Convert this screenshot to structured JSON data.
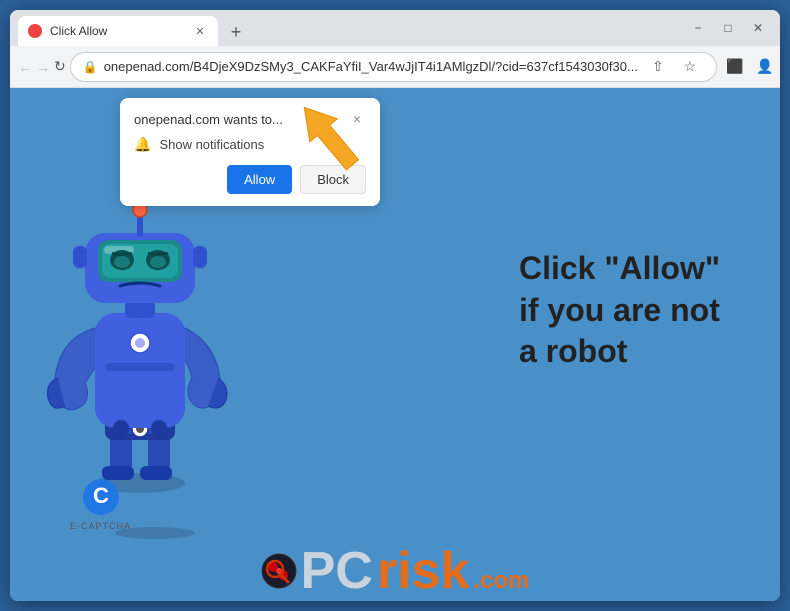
{
  "browser": {
    "title": "Click Allow",
    "tab_label": "Click Allow",
    "url": "onepenad.com/B4DjeX9DzSMy3_CAKFaYfiI_Var4wJjIT4i1AMlgzDl/?cid=637cf1543030f30...",
    "new_tab_label": "+",
    "window_controls": {
      "minimize": "−",
      "maximize": "□",
      "close": "✕"
    },
    "nav": {
      "back": "←",
      "forward": "→",
      "refresh": "↻",
      "lock": "🔒"
    }
  },
  "popup": {
    "title": "onepenad.com wants to...",
    "notification_label": "Show notifications",
    "allow_label": "Allow",
    "block_label": "Block",
    "close_label": "×"
  },
  "page": {
    "question_marks": "??",
    "main_text_line1": "Click \"Allow\"",
    "main_text_line2": "if you are not",
    "main_text_line3": "a robot",
    "ecaptcha_label": "E-CAPTCHA",
    "pcrisk_pc": "PC",
    "pcrisk_risk": "risk",
    "pcrisk_com": ".com"
  },
  "icons": {
    "back_arrow": "←",
    "forward_arrow": "→",
    "refresh": "↻",
    "lock": "🔒",
    "star": "☆",
    "share": "⇧",
    "profile": "👤",
    "menu": "⋮",
    "extensions": "⬛"
  }
}
